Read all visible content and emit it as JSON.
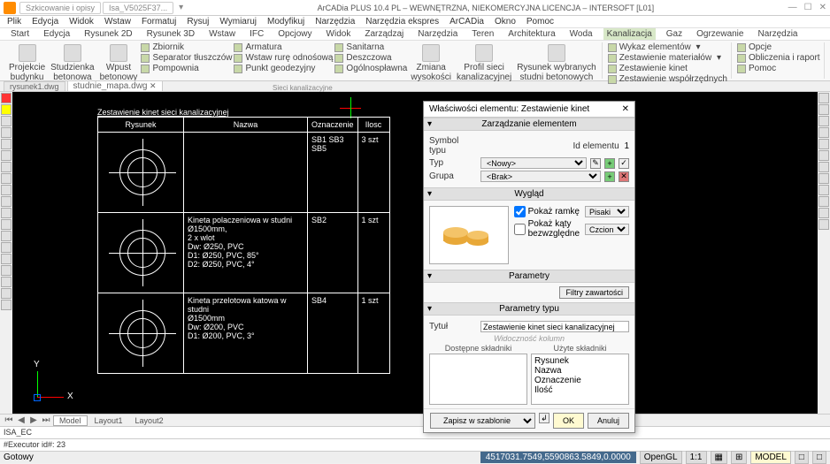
{
  "titlebar": {
    "docTabs": [
      "Szkicowanie i opisy",
      "Isa_V5025F37..."
    ],
    "title": "ArCADia PLUS 10.4 PL – WEWNĘTRZNA, NIEKOMERCYJNA LICENCJA – INTERSOFT [L01]"
  },
  "menubar": [
    "Plik",
    "Edycja",
    "Widok",
    "Wstaw",
    "Formatuj",
    "Rysuj",
    "Wymiaruj",
    "Modyfikuj",
    "Narzędzia",
    "Narzędzia ekspres",
    "ArCADia",
    "Okno",
    "Pomoc"
  ],
  "ribbonTabs": [
    "Start",
    "Edycja",
    "Rysunek 2D",
    "Rysunek 3D",
    "Wstaw",
    "IFC",
    "Opcjowy",
    "Widok",
    "Zarządzaj",
    "Narzędzia",
    "Teren",
    "Architektura",
    "Woda",
    "Kanalizacja",
    "Gaz",
    "Ogrzewanie",
    "Narzędzia"
  ],
  "ribbon": {
    "groups": [
      {
        "label": "",
        "big": [
          {
            "t": "Projekcie\nbudynku"
          },
          {
            "t": "Studzienka\nbetonowa"
          },
          {
            "t": "Wpust\nbetonowy"
          }
        ],
        "minis": [
          {
            "t": "Zbiornik"
          },
          {
            "t": "Separator tłuszczów"
          },
          {
            "t": "Pompownia"
          }
        ]
      },
      {
        "label": "",
        "minis2": [
          {
            "t": "Armatura"
          },
          {
            "t": "Wstaw rurę odnośową"
          },
          {
            "t": "Punkt geodezyjny"
          }
        ]
      },
      {
        "label": "",
        "minis2": [
          {
            "t": "Sanitarna"
          },
          {
            "t": "Deszczowa"
          },
          {
            "t": "Ogólnospławna"
          }
        ]
      },
      {
        "label": "",
        "big": [
          {
            "t": "Zmiana\nwysokości"
          }
        ]
      },
      {
        "label": "Sieci kanalizacyjne",
        "big": [
          {
            "t": "Profil sieci\nkanalizacyjnej"
          },
          {
            "t": "Rysunek wybranych\nstudni betonowych"
          }
        ]
      },
      {
        "label": "",
        "minis2": [
          {
            "t": "Wykaz elementów"
          },
          {
            "t": "Zestawienie materiałów"
          },
          {
            "t": "Zestawienie kinet"
          },
          {
            "t": "Zestawienie współrzędnych"
          }
        ]
      },
      {
        "label": "",
        "minis2": [
          {
            "t": "Opcje"
          },
          {
            "t": "Obliczenia i raport"
          },
          {
            "t": "Pomoc"
          }
        ]
      }
    ]
  },
  "docTabs": [
    "rysunek1.dwg",
    "studnie_mapa.dwg"
  ],
  "drawing": {
    "caption": "Zestawienie kinet sieci kanalizacyjnej",
    "headers": [
      "Rysunek",
      "Nazwa",
      "Oznaczenie",
      "Ilosc"
    ],
    "rows": [
      {
        "name": "",
        "ozn": "SB1 SB3 SB5",
        "ilosc": "3 szt"
      },
      {
        "name": "Kineta polaczeniowa w studni Ø1500mm,\n2 x wlot\nDw:    Ø250, PVC\nD1:    Ø250, PVC, 85°\nD2:    Ø250, PVC, 4°",
        "ozn": "SB2",
        "ilosc": "1 szt"
      },
      {
        "name": "Kineta przelotowa katowa w studni\nØ1500mm\nDw:    Ø200, PVC\nD1:    Ø200, PVC, 3°",
        "ozn": "SB4",
        "ilosc": "1 szt"
      }
    ]
  },
  "ucs": {
    "x": "X",
    "y": "Y"
  },
  "layoutTabs": [
    "Model",
    "Layout1",
    "Layout2"
  ],
  "cmdHistory": "ISA_EC",
  "cmdLine": "#Executor id#: 23",
  "status": {
    "ready": "Gotowy",
    "coords": "4517031.7549,5590863.5849,0.0000",
    "opengl": "OpenGL",
    "scale": "1:1",
    "model": "MODEL"
  },
  "dialog": {
    "title": "Właściwości elementu: Zestawienie kinet",
    "section1": "Zarządzanie elementem",
    "symbolTypu": "Symbol typu",
    "idElementu": "Id elementu",
    "idVal": "1",
    "typ": "Typ",
    "typVal": "<Nowy>",
    "grupa": "Grupa",
    "grupaVal": "<Brak>",
    "section2": "Wygląd",
    "pokazRamke": "Pokaż ramkę",
    "pokazKaty": "Pokaż kąty bezwzględne",
    "pisakiLbl": "Pisaki",
    "czcionkiLbl": "Czcionki",
    "section3": "Parametry",
    "filtry": "Filtry zawartości",
    "section4": "Parametry typu",
    "tytul": "Tytuł",
    "tytulVal": "Zestawienie kinet sieci kanalizacyjnej",
    "widocznosc": "Widoczność kolumn",
    "dostepne": "Dostępne składniki",
    "uzyte": "Użyte składniki",
    "uzyteItems": [
      "Rysunek",
      "Nazwa",
      "Oznaczenie",
      "Ilość"
    ],
    "zapisz": "Zapisz w szablonie",
    "ok": "OK",
    "anuluj": "Anuluj"
  }
}
